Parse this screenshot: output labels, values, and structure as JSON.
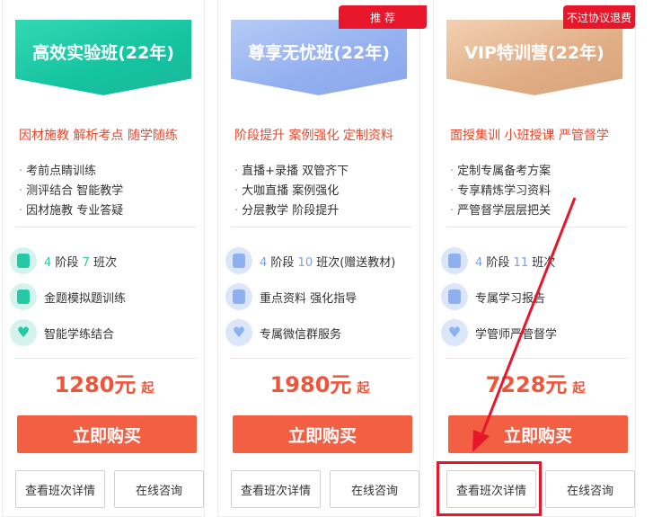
{
  "cards": [
    {
      "title": "高效实验班(22年)",
      "slogan": "因材施教 解析考点 随学随练",
      "bullets": [
        "考前点睛训练",
        "测评结合 智能教学",
        "因材施教 专业答疑"
      ],
      "features": [
        {
          "a": "4",
          "b": " 阶段 ",
          "c": "7",
          "d": " 班次"
        },
        {
          "text": "金题模拟题训练"
        },
        {
          "text": "智能学练结合"
        }
      ],
      "price": "1280元",
      "price_suffix": "起",
      "buy_label": "立即购买",
      "detail_label": "查看班次详情",
      "consult_label": "在线咨询"
    },
    {
      "title": "尊享无忧班(22年)",
      "tag": "推 荐",
      "slogan": "阶段提升 案例强化 定制资料",
      "bullets": [
        "直播+录播 双管齐下",
        "大咖直播 案例强化",
        "分层教学 阶段提升"
      ],
      "features": [
        {
          "a": "4",
          "b": " 阶段 ",
          "c": "10",
          "d": " 班次(赠送教材)"
        },
        {
          "text": "重点资料 强化指导"
        },
        {
          "text": "专属微信群服务"
        }
      ],
      "price": "1980元",
      "price_suffix": "起",
      "buy_label": "立即购买",
      "detail_label": "查看班次详情",
      "consult_label": "在线咨询"
    },
    {
      "title": "VIP特训营(22年)",
      "tag": "不过协议退费",
      "slogan": "面授集训 小班授课 严管督学",
      "bullets": [
        "定制专属备考方案",
        "专享精炼学习资料",
        "严管督学层层把关"
      ],
      "features": [
        {
          "a": "4",
          "b": " 阶段 ",
          "c": "11",
          "d": " 班次"
        },
        {
          "text": "专属学习报告"
        },
        {
          "text": "学管师严管督学"
        }
      ],
      "price": "7228元",
      "price_suffix": "起",
      "buy_label": "立即购买",
      "detail_label": "查看班次详情",
      "consult_label": "在线咨询"
    }
  ],
  "colors": {
    "accent_red": "#f25f43",
    "tag_red": "#e8162a",
    "banner_green": "#14c3a0",
    "banner_blue": "#93aff0",
    "banner_tan": "#e0ad85"
  }
}
